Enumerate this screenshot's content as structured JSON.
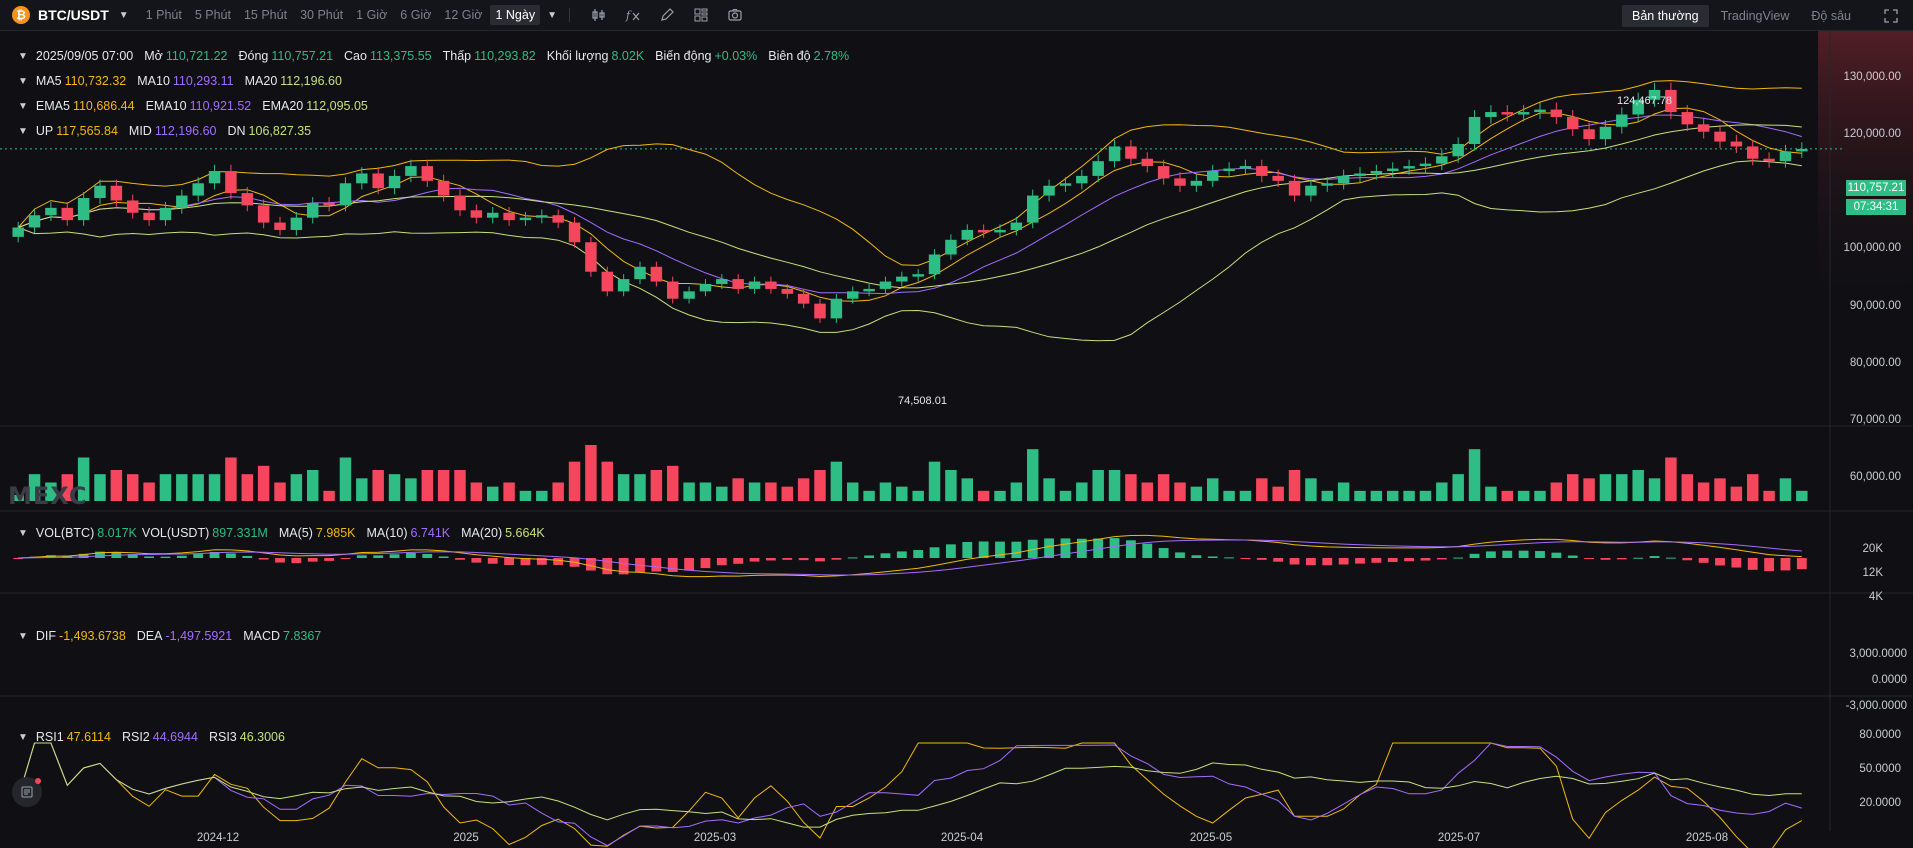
{
  "toolbar": {
    "pair": "BTC/USDT",
    "coin_icon": "₿",
    "timeframes": [
      "1 Phút",
      "5 Phút",
      "15 Phút",
      "30 Phút",
      "1 Giờ",
      "6 Giờ",
      "12 Giờ",
      "1 Ngày"
    ],
    "active_timeframe": "1 Ngày",
    "views": [
      "Bản thường",
      "TradingView",
      "Độ sâu"
    ],
    "active_view": "Bản thường"
  },
  "info": {
    "date": "2025/09/05 07:00",
    "open_label": "Mở",
    "open": "110,721.22",
    "close_label": "Đóng",
    "close": "110,757.21",
    "high_label": "Cao",
    "high": "113,375.55",
    "low_label": "Thấp",
    "low": "110,293.82",
    "vol_label": "Khối lượng",
    "vol": "8.02K",
    "change_label": "Biến động",
    "change": "+0.03%",
    "amp_label": "Biên độ",
    "amp": "2.78%"
  },
  "ma": {
    "ma5_label": "MA5",
    "ma5": "110,732.32",
    "ma10_label": "MA10",
    "ma10": "110,293.11",
    "ma20_label": "MA20",
    "ma20": "112,196.60"
  },
  "ema": {
    "ema5_label": "EMA5",
    "ema5": "110,686.44",
    "ema10_label": "EMA10",
    "ema10": "110,921.52",
    "ema20_label": "EMA20",
    "ema20": "112,095.05"
  },
  "boll": {
    "up_label": "UP",
    "up": "117,565.84",
    "mid_label": "MID",
    "mid": "112,196.60",
    "dn_label": "DN",
    "dn": "106,827.35"
  },
  "vol": {
    "vbtc_label": "VOL(BTC)",
    "vbtc": "8.017K",
    "vusdt_label": "VOL(USDT)",
    "vusdt": "897.331M",
    "ma5_label": "MA(5)",
    "ma5": "7.985K",
    "ma10_label": "MA(10)",
    "ma10": "6.741K",
    "ma20_label": "MA(20)",
    "ma20": "5.664K"
  },
  "macd": {
    "dif_label": "DIF",
    "dif": "-1,493.6738",
    "dea_label": "DEA",
    "dea": "-1,497.5921",
    "macd_label": "MACD",
    "macd": "7.8367"
  },
  "rsi": {
    "rsi1_label": "RSI1",
    "rsi1": "47.6114",
    "rsi2_label": "RSI2",
    "rsi2": "44.6944",
    "rsi3_label": "RSI3",
    "rsi3": "46.3006"
  },
  "price_axis": [
    "130,000.00",
    "120,000.00",
    "100,000.00",
    "90,000.00",
    "80,000.00",
    "70,000.00",
    "60,000.00"
  ],
  "vol_axis": [
    "20K",
    "12K",
    "4K"
  ],
  "macd_axis": [
    "3,000.0000",
    "0.0000",
    "-3,000.0000"
  ],
  "rsi_axis": [
    "80.0000",
    "50.0000",
    "20.0000"
  ],
  "date_axis": [
    "2024-12",
    "2025",
    "2025-03",
    "2025-04",
    "2025-05",
    "2025-07",
    "2025-08"
  ],
  "last_price": "110,757.21",
  "countdown": "07:34:31",
  "high_mark": "124,467.78",
  "low_mark": "74,508.01",
  "watermark": "MEXC",
  "colors": {
    "up": "#2ebd85",
    "down": "#f6465d",
    "ma5": "#f0b90b",
    "ma10": "#a36cff",
    "ma20": "#c7e07a",
    "background": "#101014"
  },
  "chart_data": {
    "type": "candlestick",
    "closes": [
      95000,
      97500,
      99000,
      96500,
      101000,
      103500,
      100500,
      98000,
      96500,
      99000,
      101500,
      104000,
      106500,
      102000,
      99500,
      96000,
      94500,
      97000,
      100000,
      99500,
      104000,
      106000,
      103000,
      105500,
      107500,
      104500,
      101500,
      98500,
      97000,
      98000,
      96500,
      97000,
      97500,
      96000,
      92000,
      86000,
      82000,
      84500,
      87000,
      84000,
      80500,
      82000,
      83500,
      84500,
      82500,
      84000,
      82500,
      81500,
      79500,
      76500,
      80500,
      82000,
      82500,
      84000,
      85000,
      85500,
      89500,
      92500,
      94500,
      94000,
      94500,
      96000,
      101500,
      103500,
      104000,
      105500,
      108500,
      111500,
      109000,
      107500,
      105000,
      103500,
      104500,
      106500,
      107000,
      107500,
      105500,
      104500,
      101500,
      103500,
      104000,
      105500,
      106000,
      106500,
      107000,
      107500,
      108000,
      109500,
      112000,
      117500,
      118500,
      118000,
      118500,
      119000,
      117500,
      115000,
      113000,
      115500,
      118000,
      121000,
      123000,
      118500,
      116000,
      114500,
      112500,
      111500,
      109000,
      108500,
      110500,
      111000
    ],
    "price_range": [
      55000,
      135000
    ]
  }
}
